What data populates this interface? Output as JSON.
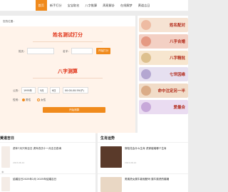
{
  "nav": {
    "items": [
      {
        "label": "首页",
        "active": true
      },
      {
        "label": "新手打分",
        "active": false
      },
      {
        "label": "宝宝取名",
        "active": false
      },
      {
        "label": "八字推算",
        "active": false
      },
      {
        "label": "周易解卦",
        "active": false
      },
      {
        "label": "在线解梦",
        "active": false
      },
      {
        "label": "黄道吉日",
        "active": false
      }
    ]
  },
  "breadcrumb": "您的位置：",
  "name_test": {
    "title": "姓名测试打分",
    "surname_label": "姓氏：",
    "given_label": "名字：",
    "submit": "开始打分"
  },
  "bazi": {
    "title": "八字测算",
    "gongli_label": "公历：",
    "year": "1995年",
    "month": "5月",
    "day": "6日",
    "hour": "00:00-00:59(子)",
    "gender_label": "性别：",
    "male": "男性",
    "female": "女性",
    "submit": "开始测算"
  },
  "banners": [
    {
      "text": "姓名配对",
      "color": "#f6e3d3",
      "deco": "#e89a7a"
    },
    {
      "text": "八字合婚",
      "color": "#f3d0c4",
      "deco": "#d96b4e"
    },
    {
      "text": "八字精批",
      "color": "#f7e6cf",
      "deco": "#c9a15a"
    },
    {
      "text": "七世因缘",
      "color": "#e6e0f0",
      "deco": "#8b78b8"
    },
    {
      "text": "命中注定另一半",
      "color": "#f1dcc8",
      "deco": "#c98554"
    },
    {
      "text": "爱最合",
      "color": "#eadcf1",
      "deco": "#a97ec4"
    }
  ],
  "luck": {
    "title": "黄道吉日",
    "articles": [
      {
        "title": "虎年7月只有吉日 虎年农历十一月吉日查询",
        "meta": "2023-08-10"
      },
      {
        "title": "结婚吉日2025年2月 2025年结婚吉日",
        "meta": "2023-08-10"
      }
    ]
  },
  "fortune": {
    "title": "生肖运势",
    "articles": [
      {
        "title": "穿桂花会什么生肖 虎穿链端哪个生肖",
        "meta": "2023-08-10"
      },
      {
        "title": "男属虎女属牛能相配吗 属牛属虎的婚姻",
        "meta": "2023-08-10"
      }
    ]
  },
  "colors": {
    "accent": "#f08a1c",
    "title_red": "#e0351a"
  }
}
